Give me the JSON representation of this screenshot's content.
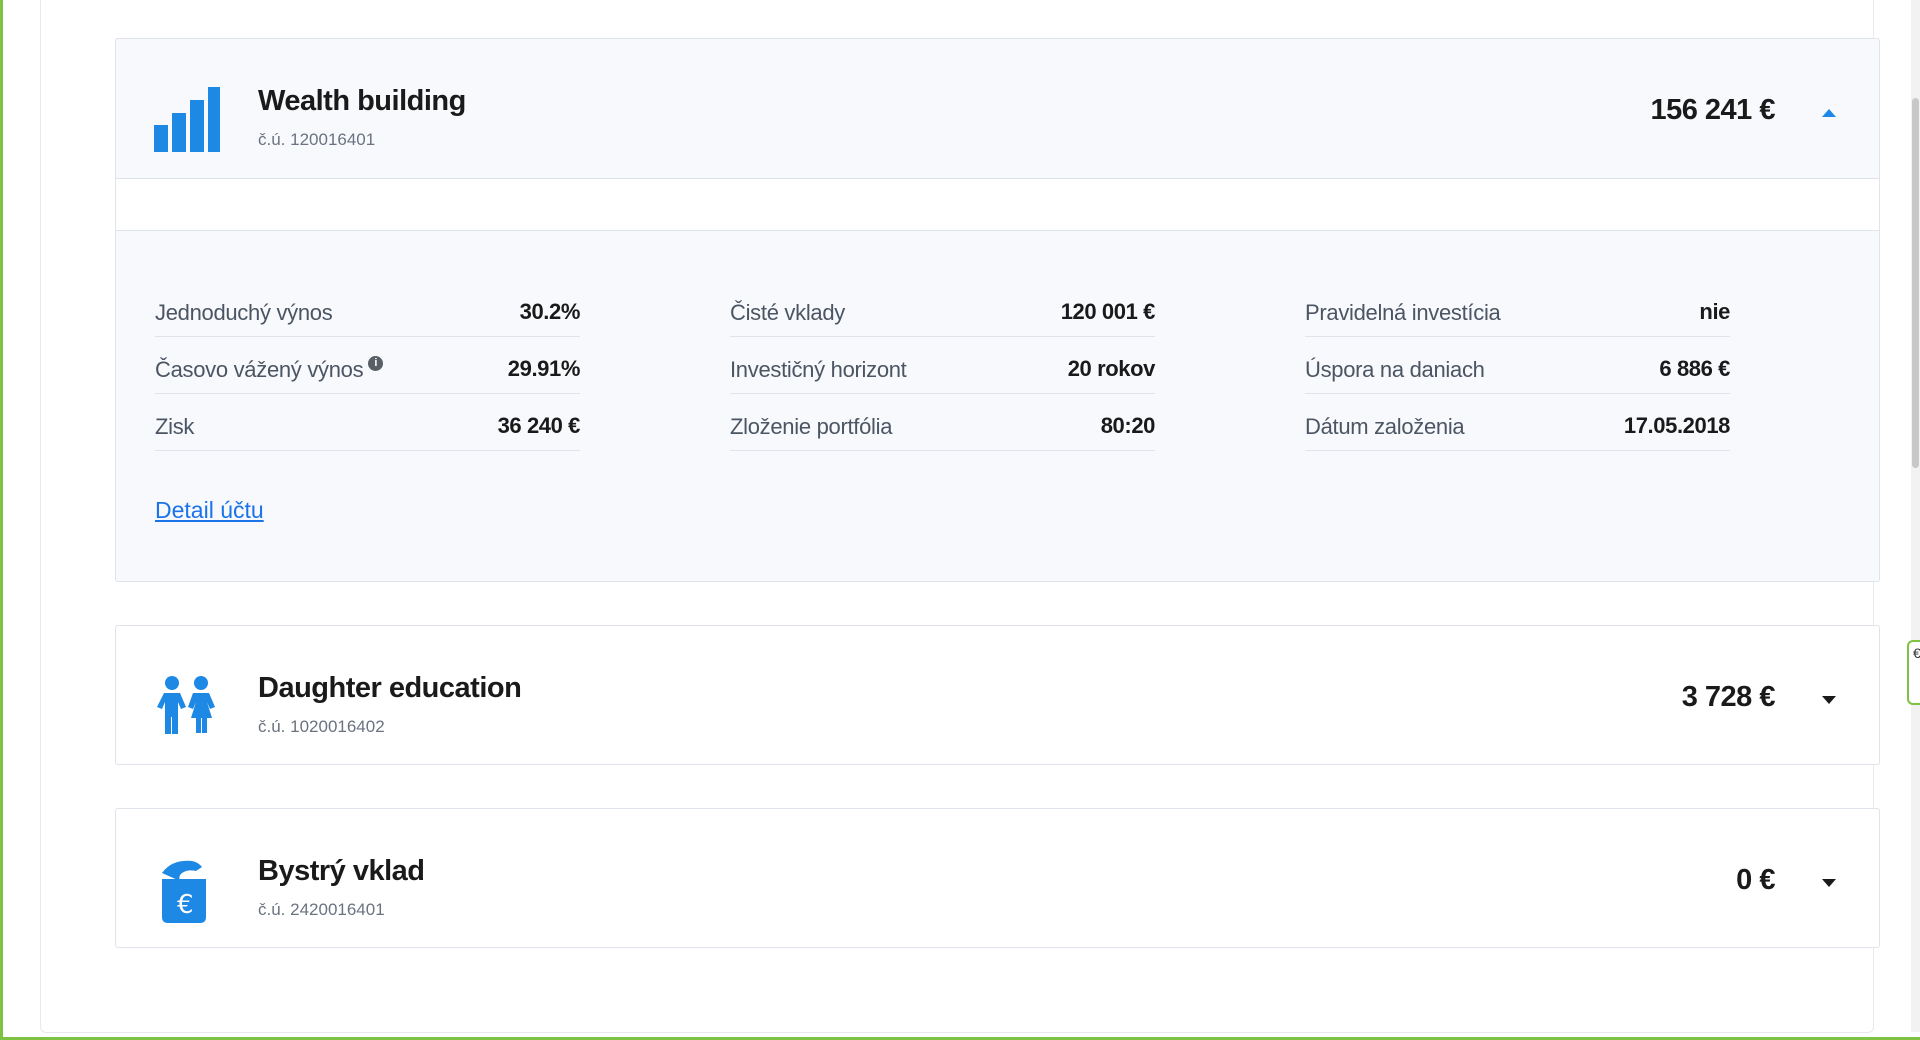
{
  "accounts": [
    {
      "name": "Wealth building",
      "number": "č.ú. 120016401",
      "amount": "156 241 €",
      "icon": "bar-chart-icon",
      "expanded": true,
      "stats": {
        "col1": [
          {
            "label": "Jednoduchý výnos",
            "value": "30.2%"
          },
          {
            "label": "Časovo vážený výnos",
            "value": "29.91%",
            "info_icon": "info-icon"
          },
          {
            "label": "Zisk",
            "value": "36 240 €"
          }
        ],
        "col2": [
          {
            "label": "Čisté vklady",
            "value": "120 001 €"
          },
          {
            "label": "Investičný horizont",
            "value": "20 rokov"
          },
          {
            "label": "Zloženie portfólia",
            "value": "80:20"
          }
        ],
        "col3": [
          {
            "label": "Pravidelná investícia",
            "value": "nie"
          },
          {
            "label": "Úspora na daniach",
            "value": "6 886 €"
          },
          {
            "label": "Dátum založenia",
            "value": "17.05.2018"
          }
        ]
      },
      "detail_link": "Detail účtu"
    },
    {
      "name": "Daughter education",
      "number": "č.ú. 1020016402",
      "amount": "3 728 €",
      "icon": "children-icon",
      "expanded": false
    },
    {
      "name": "Bystrý vklad",
      "number": "č.ú. 2420016401",
      "amount": "0 €",
      "icon": "euro-jar-icon",
      "expanded": false
    }
  ],
  "info_glyph": "i",
  "side_widget_text": "€",
  "colors": {
    "accent_blue": "#1e88e5",
    "link_blue": "#1a73e8",
    "frame_green": "#7dc242"
  }
}
